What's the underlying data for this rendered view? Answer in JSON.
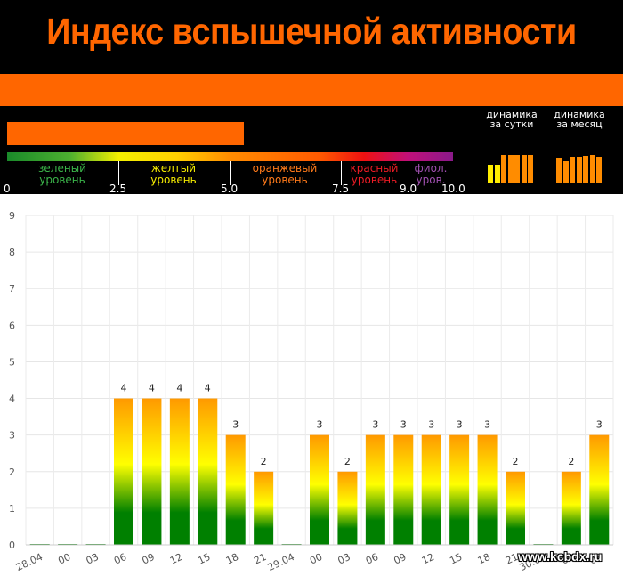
{
  "header": {
    "title": "Индекс вспышечной активности",
    "title_color": "#ff6600",
    "band_color": "#ff6600",
    "current_index": 5.3
  },
  "scale": {
    "levels": [
      {
        "line1": "зеленый",
        "line2": "уровень",
        "color": "#3bb44a"
      },
      {
        "line1": "желтый",
        "line2": "уровень",
        "color": "#f5ec00"
      },
      {
        "line1": "оранжевый",
        "line2": "уровень",
        "color": "#ff7a1a"
      },
      {
        "line1": "красный",
        "line2": "уровень",
        "color": "#ee1c25"
      },
      {
        "line1": "фиол.",
        "line2": "уров.",
        "color": "#a050b0"
      }
    ],
    "ticks": [
      "0",
      "2.5",
      "5.0",
      "7.5",
      "9.0",
      "10.0"
    ]
  },
  "dynamics": {
    "day": {
      "line1": "динамика",
      "line2": "за сутки",
      "values": [
        2,
        2,
        3,
        3,
        3,
        3,
        3
      ],
      "colors": [
        "#ffee00",
        "#ffee00",
        "#ff8c00",
        "#ff8c00",
        "#ff8c00",
        "#ff8c00",
        "#ff8c00"
      ]
    },
    "month": {
      "line1": "динамика",
      "line2": "за месяц",
      "values": [
        2.6,
        2.4,
        2.8,
        2.8,
        2.9,
        3.0,
        2.8
      ],
      "colors": [
        "#ff8c00",
        "#ff8c00",
        "#ff8c00",
        "#ff8c00",
        "#ff8c00",
        "#ff8c00",
        "#ff8c00"
      ]
    }
  },
  "chart_data": {
    "type": "bar",
    "categories": [
      "28.04",
      "00",
      "03",
      "06",
      "09",
      "12",
      "15",
      "18",
      "21",
      "29.04",
      "00",
      "03",
      "06",
      "09",
      "12",
      "15",
      "18",
      "21",
      "30.04",
      "00",
      "03"
    ],
    "values": [
      0,
      0,
      0,
      4,
      4,
      4,
      4,
      3,
      2,
      0,
      3,
      2,
      3,
      3,
      3,
      3,
      3,
      2,
      0,
      2,
      3
    ],
    "ylim": [
      0,
      9
    ],
    "yticks": [
      "0",
      "1",
      "2",
      "3",
      "4",
      "5",
      "6",
      "7",
      "8",
      "9"
    ],
    "grid": true,
    "data_labels": true,
    "bar_gradient": [
      "#008000",
      "#ffff00",
      "#ff9900"
    ]
  },
  "watermark": "www.kcbdx.ru"
}
